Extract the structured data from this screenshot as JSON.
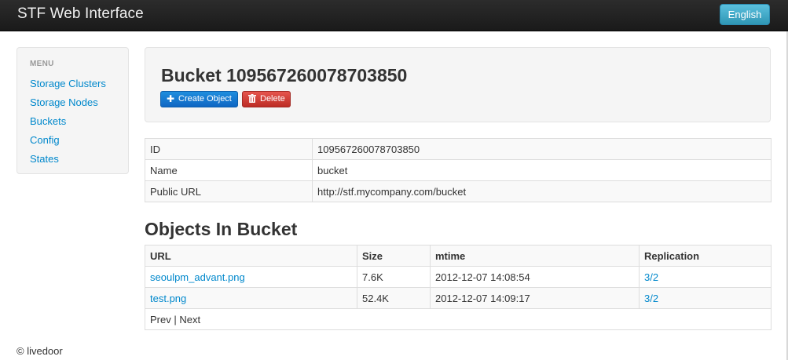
{
  "app": {
    "title": "STF Web Interface",
    "language_button": "English"
  },
  "sidebar": {
    "header": "MENU",
    "items": [
      {
        "label": "Storage Clusters"
      },
      {
        "label": "Storage Nodes"
      },
      {
        "label": "Buckets"
      },
      {
        "label": "Config"
      },
      {
        "label": "States"
      }
    ]
  },
  "bucket": {
    "title": "Bucket 109567260078703850",
    "create_button": "Create Object",
    "delete_button": "Delete",
    "info": [
      {
        "key": "ID",
        "value": "109567260078703850"
      },
      {
        "key": "Name",
        "value": "bucket"
      },
      {
        "key": "Public URL",
        "value": "http://stf.mycompany.com/bucket"
      }
    ]
  },
  "objects": {
    "title": "Objects In Bucket",
    "columns": [
      "URL",
      "Size",
      "mtime",
      "Replication"
    ],
    "rows": [
      {
        "url": "seoulpm_advant.png",
        "size": "7.6K",
        "mtime": "2012-12-07 14:08:54",
        "replication": "3/2"
      },
      {
        "url": "test.png",
        "size": "52.4K",
        "mtime": "2012-12-07 14:09:17",
        "replication": "3/2"
      }
    ],
    "pager": {
      "prev": "Prev",
      "separator": " | ",
      "next": "Next"
    }
  },
  "footer": {
    "text": "© livedoor"
  },
  "icons": {
    "create": "plus-icon",
    "delete": "trash-icon"
  }
}
